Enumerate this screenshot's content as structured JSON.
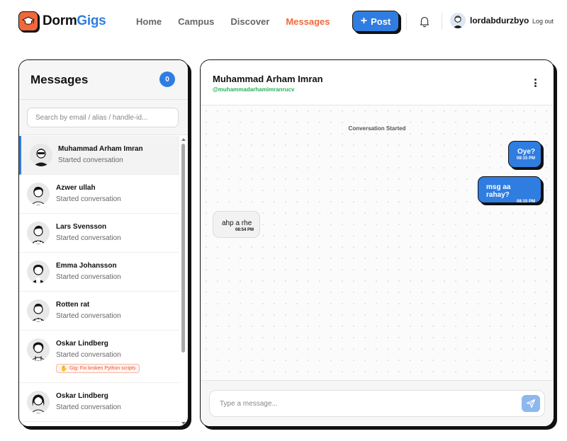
{
  "app": {
    "name_prefix": "Dorm",
    "name_accent": "Gigs"
  },
  "nav": {
    "links": [
      "Home",
      "Campus",
      "Discover",
      "Messages"
    ],
    "active": "Messages"
  },
  "post_button": {
    "label": "Post"
  },
  "user": {
    "username": "lordabdurzbyo",
    "logout_label": "Log out"
  },
  "messages_panel": {
    "title": "Messages",
    "unread_count": "0",
    "search_placeholder": "Search by email / alias / handle-id...",
    "conversations": [
      {
        "name": "Muhammad Arham Imran",
        "preview": "Started conversation",
        "active": true
      },
      {
        "name": "Azwer ullah",
        "preview": "Started conversation"
      },
      {
        "name": "Lars Svensson",
        "preview": "Started conversation"
      },
      {
        "name": "Emma Johansson",
        "preview": "Started conversation"
      },
      {
        "name": "Rotten rat",
        "preview": "Started conversation"
      },
      {
        "name": "Oskar Lindberg",
        "preview": "Started conversation",
        "gig": "Gig: Fix broken Python scripts"
      },
      {
        "name": "Oskar Lindberg",
        "preview": "Started conversation"
      }
    ]
  },
  "chat": {
    "name": "Muhammad Arham Imran",
    "handle": "@muhammadarhamimranrucv",
    "system_note": "Conversation Started",
    "messages": [
      {
        "text": "Oye?",
        "time": "08:15 PM",
        "direction": "out"
      },
      {
        "text": "msg aa rahay?",
        "time": "08:15 PM",
        "direction": "out"
      },
      {
        "text": "ahp a rhe",
        "time": "08:54 PM",
        "direction": "in"
      }
    ],
    "input_placeholder": "Type a message..."
  },
  "colors": {
    "accent_blue": "#2f7de1",
    "brand_orange": "#f0683c",
    "handle_green": "#27b05b"
  }
}
